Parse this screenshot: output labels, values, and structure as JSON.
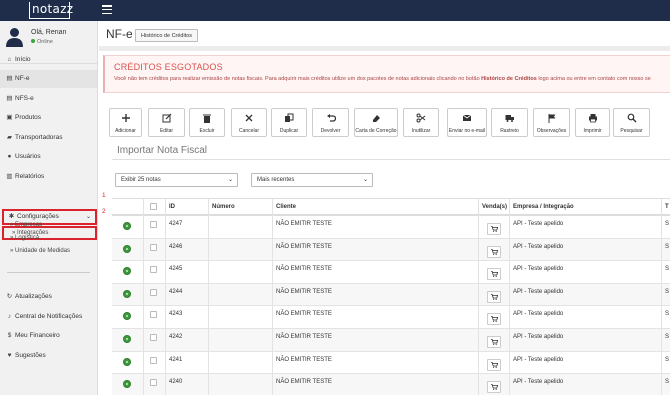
{
  "app": {
    "logo": "notazz"
  },
  "user": {
    "greeting": "Olá, Renan",
    "status": "Online"
  },
  "sidebar": {
    "items": [
      {
        "label": "Início",
        "icon": "home-icon"
      },
      {
        "label": "NF-e",
        "icon": "file-icon"
      },
      {
        "label": "NFS-e",
        "icon": "file-icon"
      },
      {
        "label": "Produtos",
        "icon": "box-icon"
      },
      {
        "label": "Transportadoras",
        "icon": "truck-icon"
      },
      {
        "label": "Usuários",
        "icon": "user-icon"
      },
      {
        "label": "Relatórios",
        "icon": "bar-chart-icon"
      }
    ],
    "config": {
      "label": "Configurações",
      "icon": "gear-icon"
    },
    "config_sub": [
      "Integrações",
      "Empresas",
      "Logística",
      "Unidade de Medidas"
    ],
    "bottom_items": [
      {
        "label": "Atualizações",
        "icon": "refresh-icon"
      },
      {
        "label": "Central de Notificações",
        "icon": "bell-icon"
      },
      {
        "label": "Meu Financeiro",
        "icon": "dollar-icon"
      },
      {
        "label": "Sugestões",
        "icon": "heart-icon"
      }
    ],
    "markers": [
      "1",
      "2"
    ]
  },
  "header": {
    "title": "NF-e",
    "history_button": "Histórico de Créditos"
  },
  "alert": {
    "title": "CRÉDITOS ESGOTADOS",
    "text_before": "Você não tem créditos para realizar emissão de notas fiscais. Para adquirir mais créditos utilize um dos pacotes de notas adicionais clicando no botão ",
    "text_bold": "Histórico de Créditos",
    "text_after": " logo acima ou entre em contato com nosso se"
  },
  "toolbar": [
    {
      "label": "Adicionar",
      "icon": "plus-icon"
    },
    {
      "label": "Editar",
      "icon": "edit-icon"
    },
    {
      "label": "Excluir",
      "icon": "trash-icon"
    },
    {
      "label": "Cancelar",
      "icon": "close-icon"
    },
    {
      "label": "Duplicar",
      "icon": "copy-icon"
    },
    {
      "label": "Devolver",
      "icon": "undo-icon"
    },
    {
      "label": "Carta de Correção",
      "icon": "eraser-icon"
    },
    {
      "label": "Inutilizar",
      "icon": "scissors-icon"
    },
    {
      "label": "Enviar no e-mail",
      "icon": "envelope-icon"
    },
    {
      "label": "Rastreio",
      "icon": "truck-icon"
    },
    {
      "label": "Observações",
      "icon": "flag-icon"
    },
    {
      "label": "Imprimir",
      "icon": "print-icon"
    },
    {
      "label": "Pesquisar",
      "icon": "search-icon"
    }
  ],
  "section": {
    "title": "Importar Nota Fiscal"
  },
  "filters": {
    "per_page": "Exibir 25 notas",
    "sort": "Mais recentes"
  },
  "table": {
    "columns": [
      "ID",
      "Número",
      "Cliente",
      "Venda(s)",
      "Empresa / Integração",
      "T"
    ],
    "rows": [
      {
        "id": "4247",
        "numero": "",
        "cliente": "NÃO EMITIR TESTE",
        "empresa": "API - Teste apelido",
        "t": "S"
      },
      {
        "id": "4246",
        "numero": "",
        "cliente": "NÃO EMITIR TESTE",
        "empresa": "API - Teste apelido",
        "t": "S"
      },
      {
        "id": "4245",
        "numero": "",
        "cliente": "NÃO EMITIR TESTE",
        "empresa": "API - Teste apelido",
        "t": "S"
      },
      {
        "id": "4244",
        "numero": "",
        "cliente": "NÃO EMITIR TESTE",
        "empresa": "API - Teste apelido",
        "t": "S"
      },
      {
        "id": "4243",
        "numero": "",
        "cliente": "NÃO EMITIR TESTE",
        "empresa": "API - Teste apelido",
        "t": "S"
      },
      {
        "id": "4242",
        "numero": "",
        "cliente": "NÃO EMITIR TESTE",
        "empresa": "API - Teste apelido",
        "t": "S"
      },
      {
        "id": "4241",
        "numero": "",
        "cliente": "NÃO EMITIR TESTE",
        "empresa": "API - Teste apelido",
        "t": "S"
      },
      {
        "id": "4240",
        "numero": "",
        "cliente": "NÃO EMITIR TESTE",
        "empresa": "API - Teste apelido",
        "t": "S"
      }
    ]
  },
  "colors": {
    "topbar": "#1f2d4b",
    "alert": "#d9534f",
    "highlight": "#d9232d",
    "status_ok": "#3c9a3c"
  }
}
